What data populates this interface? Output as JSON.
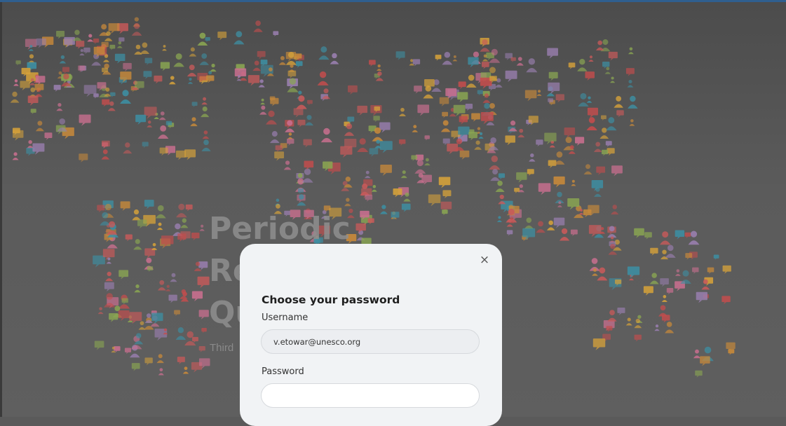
{
  "hero": {
    "title_lines": [
      "Periodic",
      "Re",
      "Qu"
    ],
    "subtitle": "Third"
  },
  "modal": {
    "close_symbol": "×",
    "title": "Choose your password",
    "username_label": "Username",
    "username_value": "v.etowar@unesco.org",
    "password_label": "Password",
    "password_value": ""
  },
  "icons": {
    "close": "close-icon",
    "background": "world-map-people-icons"
  },
  "colors": {
    "top_strip": "#2f5f8f",
    "modal_bg": "#f1f3f5",
    "map_palette": [
      "#c85a5a",
      "#3d8fa3",
      "#8aa652",
      "#d6a23a",
      "#c96f8f",
      "#9a7fb0",
      "#c98a3a",
      "#c44d4d"
    ]
  }
}
